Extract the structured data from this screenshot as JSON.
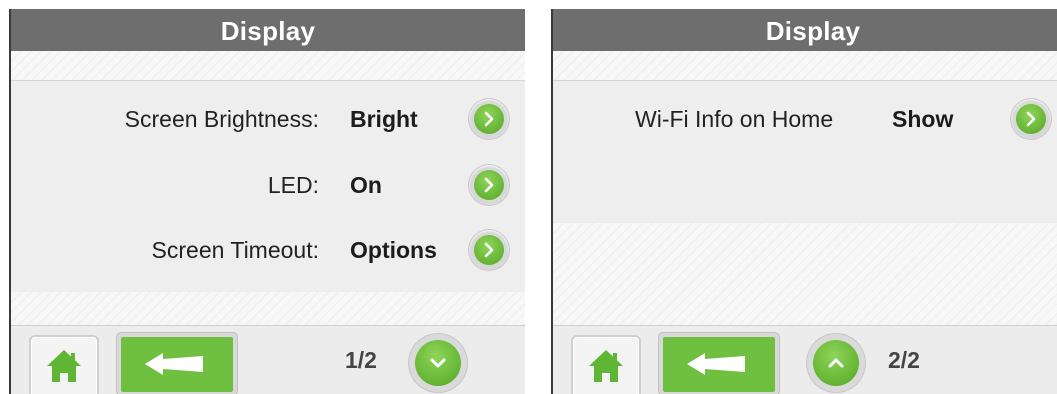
{
  "left_screen": {
    "title": "Display",
    "rows": [
      {
        "label": "Screen Brightness:",
        "value": "Bright",
        "action_icon": "chevron-right-icon"
      },
      {
        "label": "LED:",
        "value": "On",
        "action_icon": "chevron-right-icon"
      },
      {
        "label": "Screen Timeout:",
        "value": "Options",
        "action_icon": "chevron-right-icon"
      }
    ],
    "footer": {
      "home_icon": "home-icon",
      "back_icon": "back-arrow-icon",
      "page_indicator": "1/2",
      "scroll_icon": "chevron-down-icon"
    }
  },
  "right_screen": {
    "title": "Display",
    "rows": [
      {
        "label": "Wi-Fi Info on Home",
        "value": "Show",
        "action_icon": "chevron-right-icon"
      }
    ],
    "footer": {
      "home_icon": "home-icon",
      "back_icon": "back-arrow-icon",
      "scroll_icon": "chevron-up-icon",
      "page_indicator": "2/2"
    }
  },
  "colors": {
    "titlebar": "#6e6e6e",
    "accent_green": "#6fc040",
    "background": "#eeeeee"
  }
}
